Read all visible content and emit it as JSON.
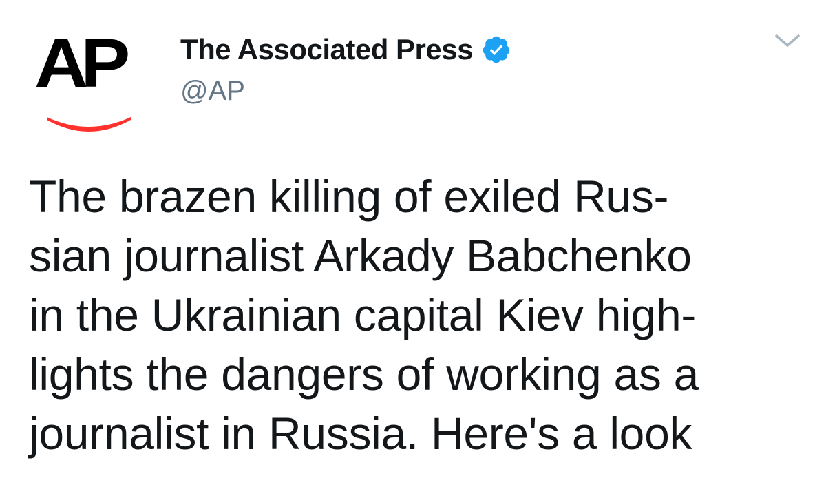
{
  "author": {
    "display_name": "The Associated Press",
    "handle": "@AP",
    "verified": true,
    "avatar_logo_text": "AP"
  },
  "colors": {
    "text": "#14171a",
    "secondary_text": "#657786",
    "verified_blue": "#1da1f2",
    "logo_red": "#ff322e",
    "caret": "#aab8c2"
  },
  "icons": {
    "verified": "verified-badge-icon",
    "menu": "chevron-down-icon"
  },
  "tweet": {
    "lines": [
      "The brazen killing of exiled Rus-",
      "sian journalist Arkady Babchenko",
      "in the Ukrainian capital Kiev high-",
      "lights the dangers of working as a",
      "journalist in Russia. Here's a look"
    ]
  }
}
